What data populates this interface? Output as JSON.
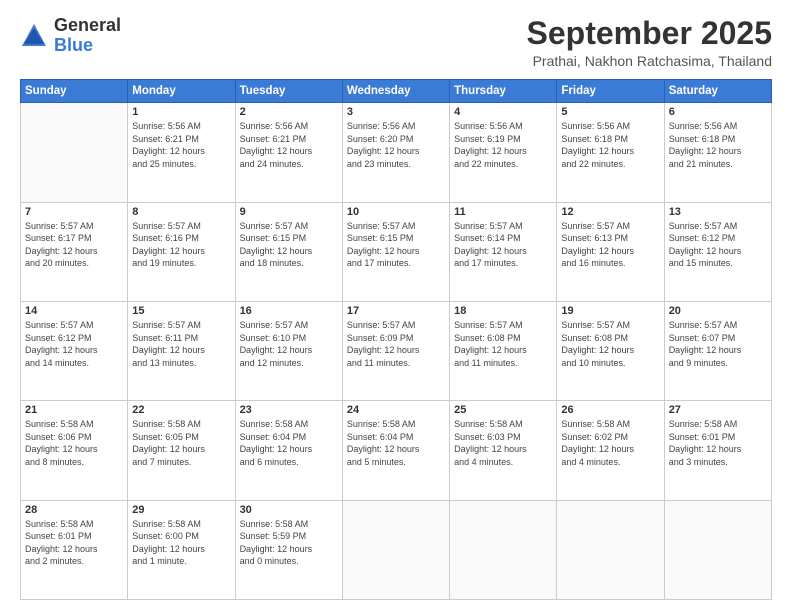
{
  "logo": {
    "general": "General",
    "blue": "Blue"
  },
  "header": {
    "title": "September 2025",
    "subtitle": "Prathai, Nakhon Ratchasima, Thailand"
  },
  "weekdays": [
    "Sunday",
    "Monday",
    "Tuesday",
    "Wednesday",
    "Thursday",
    "Friday",
    "Saturday"
  ],
  "weeks": [
    [
      {
        "day": "",
        "info": ""
      },
      {
        "day": "1",
        "info": "Sunrise: 5:56 AM\nSunset: 6:21 PM\nDaylight: 12 hours\nand 25 minutes."
      },
      {
        "day": "2",
        "info": "Sunrise: 5:56 AM\nSunset: 6:21 PM\nDaylight: 12 hours\nand 24 minutes."
      },
      {
        "day": "3",
        "info": "Sunrise: 5:56 AM\nSunset: 6:20 PM\nDaylight: 12 hours\nand 23 minutes."
      },
      {
        "day": "4",
        "info": "Sunrise: 5:56 AM\nSunset: 6:19 PM\nDaylight: 12 hours\nand 22 minutes."
      },
      {
        "day": "5",
        "info": "Sunrise: 5:56 AM\nSunset: 6:18 PM\nDaylight: 12 hours\nand 22 minutes."
      },
      {
        "day": "6",
        "info": "Sunrise: 5:56 AM\nSunset: 6:18 PM\nDaylight: 12 hours\nand 21 minutes."
      }
    ],
    [
      {
        "day": "7",
        "info": "Sunrise: 5:57 AM\nSunset: 6:17 PM\nDaylight: 12 hours\nand 20 minutes."
      },
      {
        "day": "8",
        "info": "Sunrise: 5:57 AM\nSunset: 6:16 PM\nDaylight: 12 hours\nand 19 minutes."
      },
      {
        "day": "9",
        "info": "Sunrise: 5:57 AM\nSunset: 6:15 PM\nDaylight: 12 hours\nand 18 minutes."
      },
      {
        "day": "10",
        "info": "Sunrise: 5:57 AM\nSunset: 6:15 PM\nDaylight: 12 hours\nand 17 minutes."
      },
      {
        "day": "11",
        "info": "Sunrise: 5:57 AM\nSunset: 6:14 PM\nDaylight: 12 hours\nand 17 minutes."
      },
      {
        "day": "12",
        "info": "Sunrise: 5:57 AM\nSunset: 6:13 PM\nDaylight: 12 hours\nand 16 minutes."
      },
      {
        "day": "13",
        "info": "Sunrise: 5:57 AM\nSunset: 6:12 PM\nDaylight: 12 hours\nand 15 minutes."
      }
    ],
    [
      {
        "day": "14",
        "info": "Sunrise: 5:57 AM\nSunset: 6:12 PM\nDaylight: 12 hours\nand 14 minutes."
      },
      {
        "day": "15",
        "info": "Sunrise: 5:57 AM\nSunset: 6:11 PM\nDaylight: 12 hours\nand 13 minutes."
      },
      {
        "day": "16",
        "info": "Sunrise: 5:57 AM\nSunset: 6:10 PM\nDaylight: 12 hours\nand 12 minutes."
      },
      {
        "day": "17",
        "info": "Sunrise: 5:57 AM\nSunset: 6:09 PM\nDaylight: 12 hours\nand 11 minutes."
      },
      {
        "day": "18",
        "info": "Sunrise: 5:57 AM\nSunset: 6:08 PM\nDaylight: 12 hours\nand 11 minutes."
      },
      {
        "day": "19",
        "info": "Sunrise: 5:57 AM\nSunset: 6:08 PM\nDaylight: 12 hours\nand 10 minutes."
      },
      {
        "day": "20",
        "info": "Sunrise: 5:57 AM\nSunset: 6:07 PM\nDaylight: 12 hours\nand 9 minutes."
      }
    ],
    [
      {
        "day": "21",
        "info": "Sunrise: 5:58 AM\nSunset: 6:06 PM\nDaylight: 12 hours\nand 8 minutes."
      },
      {
        "day": "22",
        "info": "Sunrise: 5:58 AM\nSunset: 6:05 PM\nDaylight: 12 hours\nand 7 minutes."
      },
      {
        "day": "23",
        "info": "Sunrise: 5:58 AM\nSunset: 6:04 PM\nDaylight: 12 hours\nand 6 minutes."
      },
      {
        "day": "24",
        "info": "Sunrise: 5:58 AM\nSunset: 6:04 PM\nDaylight: 12 hours\nand 5 minutes."
      },
      {
        "day": "25",
        "info": "Sunrise: 5:58 AM\nSunset: 6:03 PM\nDaylight: 12 hours\nand 4 minutes."
      },
      {
        "day": "26",
        "info": "Sunrise: 5:58 AM\nSunset: 6:02 PM\nDaylight: 12 hours\nand 4 minutes."
      },
      {
        "day": "27",
        "info": "Sunrise: 5:58 AM\nSunset: 6:01 PM\nDaylight: 12 hours\nand 3 minutes."
      }
    ],
    [
      {
        "day": "28",
        "info": "Sunrise: 5:58 AM\nSunset: 6:01 PM\nDaylight: 12 hours\nand 2 minutes."
      },
      {
        "day": "29",
        "info": "Sunrise: 5:58 AM\nSunset: 6:00 PM\nDaylight: 12 hours\nand 1 minute."
      },
      {
        "day": "30",
        "info": "Sunrise: 5:58 AM\nSunset: 5:59 PM\nDaylight: 12 hours\nand 0 minutes."
      },
      {
        "day": "",
        "info": ""
      },
      {
        "day": "",
        "info": ""
      },
      {
        "day": "",
        "info": ""
      },
      {
        "day": "",
        "info": ""
      }
    ]
  ]
}
